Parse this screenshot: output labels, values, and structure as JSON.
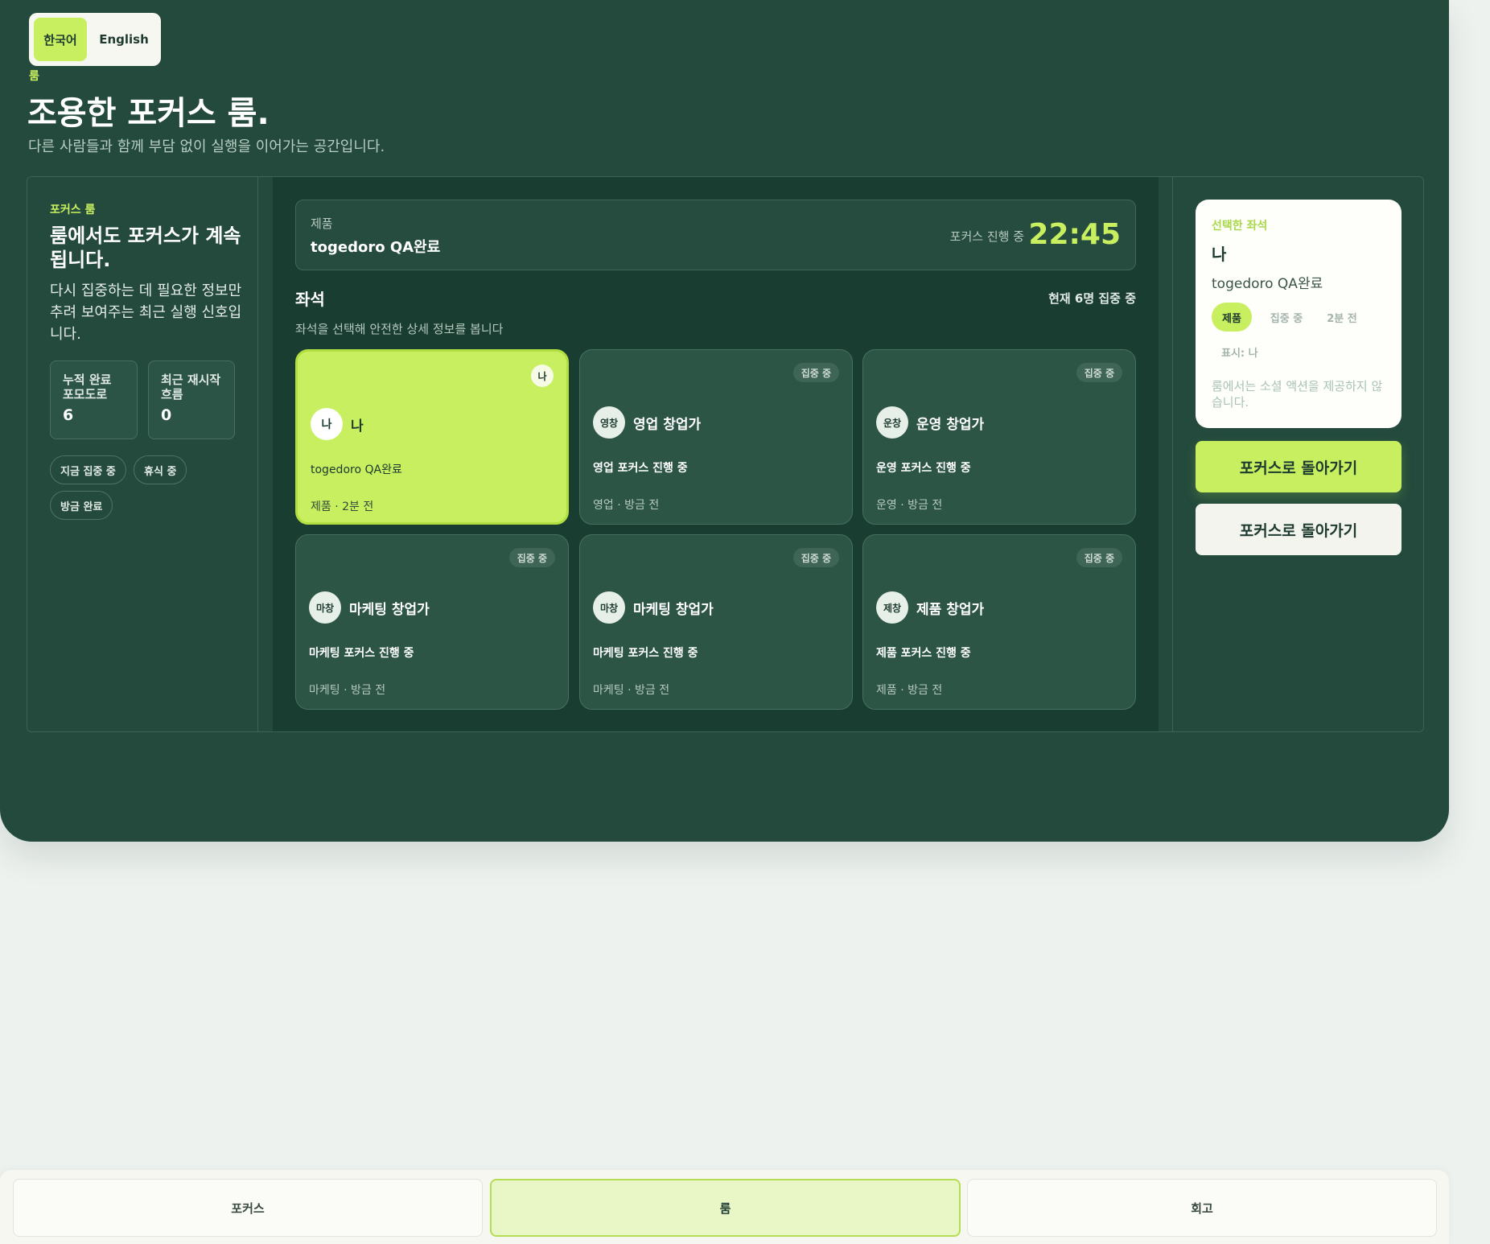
{
  "lang": {
    "ko": "한국어",
    "en": "English"
  },
  "header": {
    "eyebrow": "룸",
    "title": "조용한 포커스 룸.",
    "subtitle": "다른 사람들과 함께 부담 없이 실행을 이어가는 공간입니다."
  },
  "left": {
    "eyebrow": "포커스 룸",
    "headline": "룸에서도 포커스가 계속됩니다.",
    "desc": "다시 집중하는 데 필요한 정보만 추려 보여주는 최근 실행 신호입니다.",
    "stats": [
      {
        "label": "누적 완료 포모도로",
        "value": "6"
      },
      {
        "label": "최근 재시작 흐름",
        "value": "0"
      }
    ],
    "chips": [
      "지금 집중 중",
      "휴식 중",
      "방금 완료"
    ]
  },
  "focus": {
    "category": "제품",
    "task": "togedoro QA완료",
    "status": "포커스 진행 중",
    "timer": "22:45"
  },
  "seats": {
    "title": "좌석",
    "count": "현재 6명 집중 중",
    "hint": "좌석을 선택해 안전한 상세 정보를 봅니다",
    "items": [
      {
        "badge": "나",
        "avatar": "나",
        "name": "나",
        "line1": "togedoro QA완료",
        "line2": "제품 · 2분 전"
      },
      {
        "badge": "집중 중",
        "avatar": "영창",
        "name": "영업 창업가",
        "line1": "영업 포커스 진행 중",
        "line2": "영업 · 방금 전"
      },
      {
        "badge": "집중 중",
        "avatar": "운창",
        "name": "운영 창업가",
        "line1": "운영 포커스 진행 중",
        "line2": "운영 · 방금 전"
      },
      {
        "badge": "집중 중",
        "avatar": "마창",
        "name": "마케팅 창업가",
        "line1": "마케팅 포커스 진행 중",
        "line2": "마케팅 · 방금 전"
      },
      {
        "badge": "집중 중",
        "avatar": "마창",
        "name": "마케팅 창업가",
        "line1": "마케팅 포커스 진행 중",
        "line2": "마케팅 · 방금 전"
      },
      {
        "badge": "집중 중",
        "avatar": "제창",
        "name": "제품 창업가",
        "line1": "제품 포커스 진행 중",
        "line2": "제품 · 방금 전"
      }
    ]
  },
  "detail": {
    "eyebrow": "선택한 좌석",
    "who": "나",
    "task": "togedoro QA완료",
    "pills": [
      "제품",
      "집중 중",
      "2분 전"
    ],
    "label": "표시: 나",
    "note": "룸에서는 소셜 액션을 제공하지 않습니다."
  },
  "actions": {
    "primary": "포커스로 돌아가기",
    "secondary": "포커스로 돌아가기"
  },
  "tabs": [
    "포커스",
    "룸",
    "회고"
  ],
  "colors": {
    "bg": "#234a3d",
    "accent": "#c8ef5f",
    "page": "#eef2ef"
  }
}
